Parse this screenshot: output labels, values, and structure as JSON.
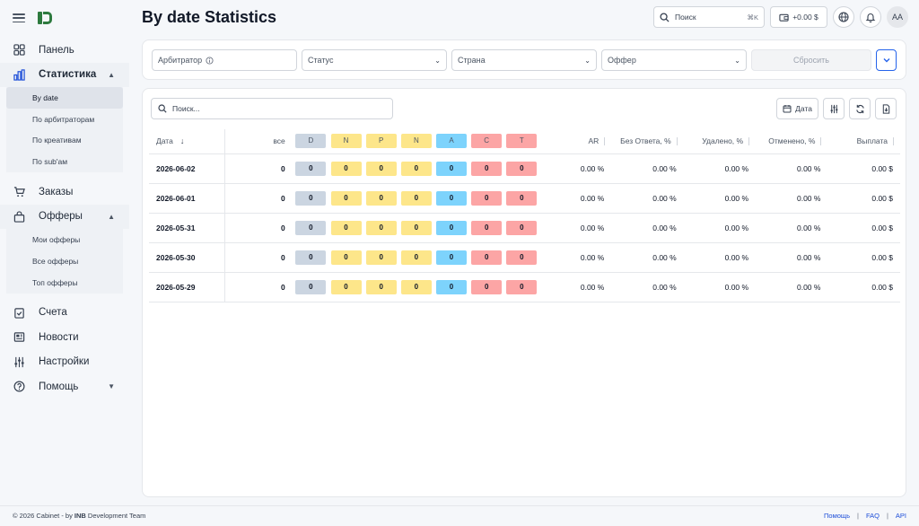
{
  "page_title": "By date Statistics",
  "header": {
    "search_label": "Поиск",
    "search_shortcut": "⌘K",
    "balance": "+0.00 $",
    "avatar_initials": "AA"
  },
  "sidebar": {
    "items": [
      {
        "label": "Панель",
        "icon": "grid-icon"
      },
      {
        "label": "Статистика",
        "icon": "bar-chart-icon",
        "expanded": true,
        "children": [
          "By date",
          "По арбитраторам",
          "По креативам",
          "По sub'ам"
        ]
      },
      {
        "label": "Заказы",
        "icon": "cart-icon"
      },
      {
        "label": "Офферы",
        "icon": "bag-icon",
        "expanded": true,
        "children": [
          "Мои офферы",
          "Все офферы",
          "Топ офферы"
        ]
      },
      {
        "label": "Счета",
        "icon": "clipboard-icon"
      },
      {
        "label": "Новости",
        "icon": "newspaper-icon"
      },
      {
        "label": "Настройки",
        "icon": "sliders-icon"
      },
      {
        "label": "Помощь",
        "icon": "help-icon"
      }
    ],
    "active_sub": "By date"
  },
  "filters": {
    "arbitrator": "Арбитратор",
    "status": "Статус",
    "country": "Страна",
    "offer": "Оффер",
    "reset": "Сбросить"
  },
  "table": {
    "search_placeholder": "Поиск...",
    "date_button": "Дата",
    "columns": {
      "date": "Дата",
      "all": "все",
      "statuses": [
        {
          "label": "D",
          "color": "#cbd5e1"
        },
        {
          "label": "N",
          "color": "#fde68a"
        },
        {
          "label": "P",
          "color": "#fde68a"
        },
        {
          "label": "N",
          "color": "#fde68a"
        },
        {
          "label": "A",
          "color": "#7dd3fc"
        },
        {
          "label": "C",
          "color": "#fca5a5"
        },
        {
          "label": "T",
          "color": "#fca5a5"
        }
      ],
      "ar": "AR",
      "no_answer": "Без Ответа, %",
      "deleted": "Удалено, %",
      "cancelled": "Отменено, %",
      "payout": "Выплата"
    },
    "rows": [
      {
        "date": "2026-06-02",
        "all": "0",
        "statuses": [
          "0",
          "0",
          "0",
          "0",
          "0",
          "0",
          "0"
        ],
        "ar": "0.00 %",
        "no_answer": "0.00 %",
        "deleted": "0.00 %",
        "cancelled": "0.00 %",
        "payout": "0.00 $"
      },
      {
        "date": "2026-06-01",
        "all": "0",
        "statuses": [
          "0",
          "0",
          "0",
          "0",
          "0",
          "0",
          "0"
        ],
        "ar": "0.00 %",
        "no_answer": "0.00 %",
        "deleted": "0.00 %",
        "cancelled": "0.00 %",
        "payout": "0.00 $"
      },
      {
        "date": "2026-05-31",
        "all": "0",
        "statuses": [
          "0",
          "0",
          "0",
          "0",
          "0",
          "0",
          "0"
        ],
        "ar": "0.00 %",
        "no_answer": "0.00 %",
        "deleted": "0.00 %",
        "cancelled": "0.00 %",
        "payout": "0.00 $"
      },
      {
        "date": "2026-05-30",
        "all": "0",
        "statuses": [
          "0",
          "0",
          "0",
          "0",
          "0",
          "0",
          "0"
        ],
        "ar": "0.00 %",
        "no_answer": "0.00 %",
        "deleted": "0.00 %",
        "cancelled": "0.00 %",
        "payout": "0.00 $"
      },
      {
        "date": "2026-05-29",
        "all": "0",
        "statuses": [
          "0",
          "0",
          "0",
          "0",
          "0",
          "0",
          "0"
        ],
        "ar": "0.00 %",
        "no_answer": "0.00 %",
        "deleted": "0.00 %",
        "cancelled": "0.00 %",
        "payout": "0.00 $"
      }
    ]
  },
  "footer": {
    "copyright_prefix": "© 2026 Cabinet - by ",
    "copyright_brand": "INB",
    "copyright_suffix": " Development Team",
    "links": [
      "Помощь",
      "FAQ",
      "API"
    ]
  }
}
